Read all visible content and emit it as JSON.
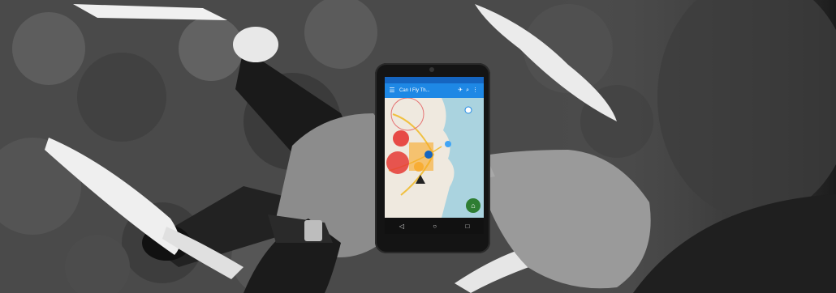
{
  "photo": {
    "subject": "hands holding smartphone over drone",
    "tone": "monochrome background, color phone screen"
  },
  "app": {
    "title": "Can I Fly Th...",
    "toolbar_icons": [
      "drone-icon",
      "search-icon",
      "more-icon"
    ],
    "nav_icons": [
      "back-icon",
      "home-icon",
      "recents-icon"
    ],
    "accent_color": "#1e88e5",
    "status_bar_color": "#1565c0",
    "fab_color": "#2e7d32",
    "restricted_zone_color": "#e53935",
    "warning_zone_color": "#f9a825"
  }
}
